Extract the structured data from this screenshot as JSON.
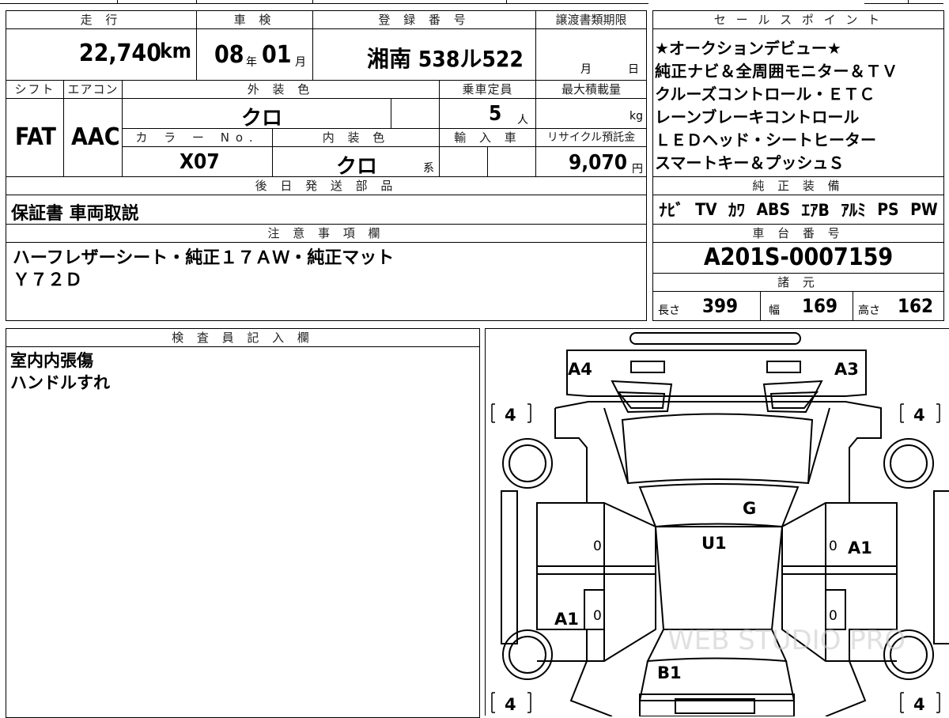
{
  "top_table": {
    "headers": {
      "mileage": "走 行",
      "inspection": "車 検",
      "registration": "登 録 番 号",
      "transfer_deadline": "譲渡書類期限",
      "shift": "シフト",
      "aircon": "エアコン",
      "exterior_color": "外 装 色",
      "capacity": "乗車定員",
      "max_load": "最大積載量",
      "color_no": "カ ラ ー No.",
      "interior_color": "内 装 色",
      "import": "輸 入 車",
      "recycle": "リサイクル預託金",
      "later_parts": "後 日 発 送 部 品"
    },
    "mileage": "22,740",
    "mileage_unit": "km",
    "inspection_year": "08",
    "inspection_year_unit": "年",
    "inspection_month": "01",
    "inspection_month_unit": "月",
    "registration_number": "湘南 538ル522",
    "transfer_month_unit": "月",
    "transfer_day_unit": "日",
    "shift": "FAT",
    "aircon": "AAC",
    "exterior_color": "クロ",
    "capacity": "5",
    "capacity_unit": "人",
    "max_load_unit": "kg",
    "color_no": "X07",
    "interior_color": "クロ",
    "interior_suffix": "系",
    "recycle_fee": "9,070",
    "recycle_unit": "円",
    "later_parts": "保証書 車両取説"
  },
  "sales_points": {
    "header": "セ ー ル ス ポ イ ン ト",
    "lines": [
      "★オークションデビュー★",
      "純正ナビ＆全周囲モニター＆ＴＶ",
      "クルーズコントロール・ＥＴＣ",
      "レーンブレーキコントロール",
      "ＬＥＤヘッド・シートヒーター",
      "スマートキー＆プッシュＳ"
    ]
  },
  "genuine_equipment": {
    "header": "純 正 装 備",
    "items": [
      "ﾅﾋﾞ",
      "TV",
      "ｶﾜ",
      "ABS",
      "ｴｱB",
      "ｱﾙﾐ",
      "PS",
      "PW"
    ]
  },
  "notes": {
    "header": "注 意 事 項 欄",
    "lines": [
      "ハーフレザーシート・純正１７ＡＷ・純正マット",
      "Ｙ７２Ｄ"
    ]
  },
  "chassis": {
    "header": "車 台 番 号",
    "number": "A201S-0007159",
    "spec_header": "諸 元",
    "length_label": "長さ",
    "length": "399",
    "width_label": "幅",
    "width": "169",
    "height_label": "高さ",
    "height": "162"
  },
  "inspector": {
    "header": "検 査 員 記 入 欄",
    "lines": [
      "室内内張傷",
      "ハンドルすれ"
    ]
  },
  "diagram": {
    "markers": {
      "front_left": "A4",
      "front_right": "A3",
      "hood_center": "G",
      "roof": "U1",
      "right_door": "A1",
      "left_rear_door": "A1",
      "rear": "B1"
    },
    "tire_tread": "4",
    "door_counts": [
      "0",
      "0",
      "0",
      "0"
    ],
    "watermark": "WEB STUDIO PRO"
  }
}
